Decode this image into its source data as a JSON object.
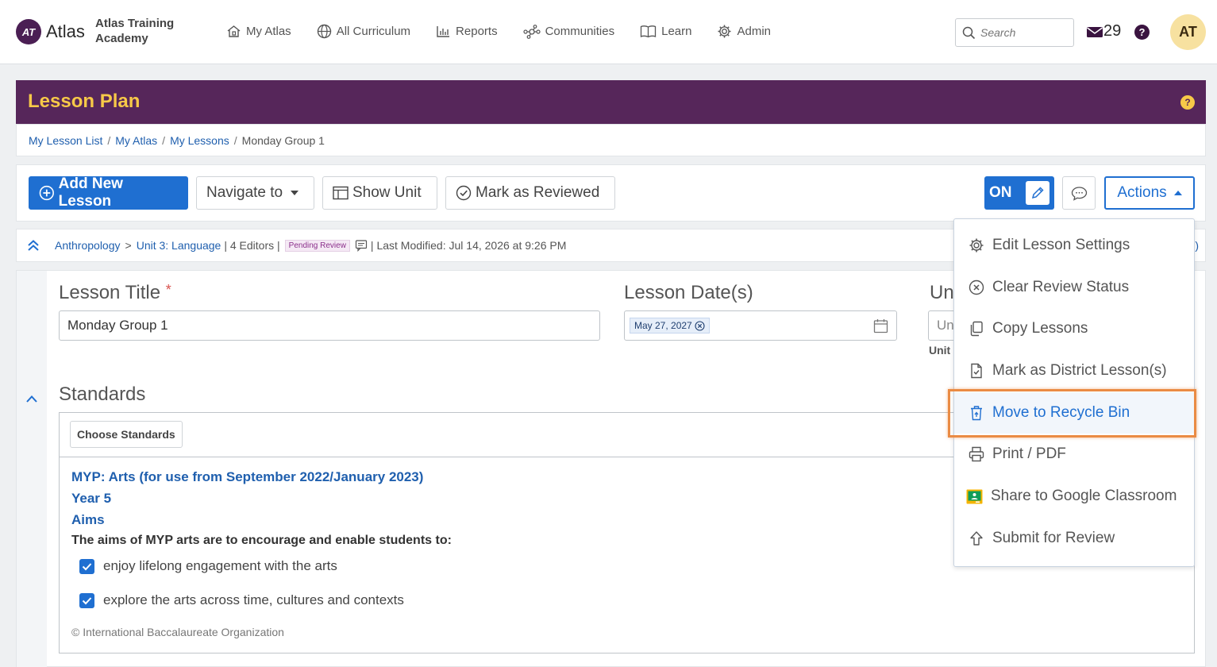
{
  "app": {
    "logo_text": "Atlas",
    "logo_badge": "AT",
    "org_name_line1": "Atlas Training",
    "org_name_line2": "Academy"
  },
  "nav": {
    "items": [
      {
        "label": "My Atlas",
        "icon": "home-icon"
      },
      {
        "label": "All Curriculum",
        "icon": "globe-icon"
      },
      {
        "label": "Reports",
        "icon": "bar-chart-icon"
      },
      {
        "label": "Communities",
        "icon": "network-icon"
      },
      {
        "label": "Learn",
        "icon": "book-icon"
      },
      {
        "label": "Admin",
        "icon": "gear-icon"
      }
    ],
    "search_placeholder": "Search",
    "mail_count": "29",
    "help_label": "?",
    "avatar_initials": "AT"
  },
  "header": {
    "title": "Lesson Plan",
    "help_label": "?"
  },
  "breadcrumb": {
    "items": [
      "My Lesson List",
      "My Atlas",
      "My Lessons"
    ],
    "current": "Monday Group 1"
  },
  "toolbar": {
    "add_new_lesson": "Add New Lesson",
    "navigate_to": "Navigate to",
    "show_unit": "Show Unit",
    "mark_as_reviewed": "Mark as Reviewed",
    "toggle_label": "ON",
    "actions": "Actions"
  },
  "infobar": {
    "course": "Anthropology",
    "unit": "Unit 3: Language",
    "editors": "| 4 Editors |",
    "status_badge": "Pending Review",
    "last_modified": "| Last Modified: Jul 14, 2026 at 9:26 PM"
  },
  "lesson": {
    "title_label": "Lesson Title",
    "required_mark": "*",
    "title_value": "Monday Group 1",
    "date_label": "Lesson Date(s)",
    "date_value": "May 27, 2027",
    "unit_label_partial": "Un",
    "unit_field_partial": "Un",
    "unit_sub_partial": "Unit"
  },
  "standards": {
    "heading": "Standards",
    "choose_button": "Choose Standards",
    "framework": "MYP: Arts (for use from September 2022/January 2023)",
    "year": "Year 5",
    "category": "Aims",
    "intro": "The aims of MYP arts are to encourage and enable students to:",
    "items": [
      "enjoy lifelong engagement with the arts",
      "explore the arts across time, cultures and contexts"
    ],
    "copyright": "© International Baccalaureate Organization"
  },
  "actions_menu": {
    "items": [
      {
        "label": "Edit Lesson Settings",
        "icon": "gear-icon"
      },
      {
        "label": "Clear Review Status",
        "icon": "circle-x-icon"
      },
      {
        "label": "Copy Lessons",
        "icon": "copy-icon"
      },
      {
        "label": "Mark as District Lesson(s)",
        "icon": "file-check-icon"
      },
      {
        "label": "Move to Recycle Bin",
        "icon": "recycle-bin-icon"
      },
      {
        "label": "Print / PDF",
        "icon": "printer-icon"
      },
      {
        "label": "Share to Google Classroom",
        "icon": "google-classroom-icon"
      },
      {
        "label": "Submit for Review",
        "icon": "upload-arrow-icon"
      }
    ]
  },
  "colors": {
    "brand_purple": "#56265a",
    "accent_yellow": "#f7c948",
    "primary_blue": "#1f6fd1",
    "highlight_orange": "#ea8b44"
  }
}
